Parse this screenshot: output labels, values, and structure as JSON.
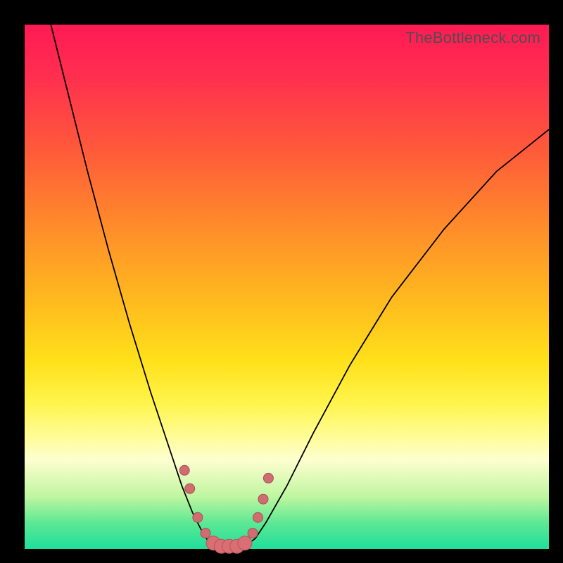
{
  "watermark": "TheBottleneck.com",
  "colors": {
    "background_frame": "#000000",
    "gradient_top": "#ff1a55",
    "gradient_bottom": "#1fdf9c",
    "curve_stroke": "#000000",
    "marker_fill": "#d96f74",
    "marker_stroke": "#b85358"
  },
  "chart_data": {
    "type": "line",
    "title": "",
    "xlabel": "",
    "ylabel": "",
    "xlim": [
      0,
      100
    ],
    "ylim": [
      0,
      100
    ],
    "grid": false,
    "legend": false,
    "series": [
      {
        "name": "left-curve",
        "x": [
          5,
          8,
          12,
          16,
          20,
          24,
          28,
          30,
          32,
          34,
          35,
          36
        ],
        "y": [
          100,
          88,
          72,
          57,
          43,
          30,
          18,
          12,
          7,
          3,
          1.5,
          0.5
        ]
      },
      {
        "name": "right-curve",
        "x": [
          42,
          44,
          46,
          50,
          55,
          62,
          70,
          80,
          90,
          100
        ],
        "y": [
          0.5,
          2,
          5,
          12,
          22,
          35,
          48,
          61,
          72,
          80
        ]
      },
      {
        "name": "valley-markers",
        "x": [
          30.5,
          31.5,
          33,
          34.5,
          36,
          37.5,
          39,
          40.5,
          42,
          43.5,
          44.5,
          45.5,
          46.5
        ],
        "y": [
          15,
          11.5,
          6,
          3,
          1.1,
          0.5,
          0.5,
          0.5,
          1.1,
          3,
          6,
          9.5,
          13.5
        ]
      }
    ],
    "annotations": []
  }
}
